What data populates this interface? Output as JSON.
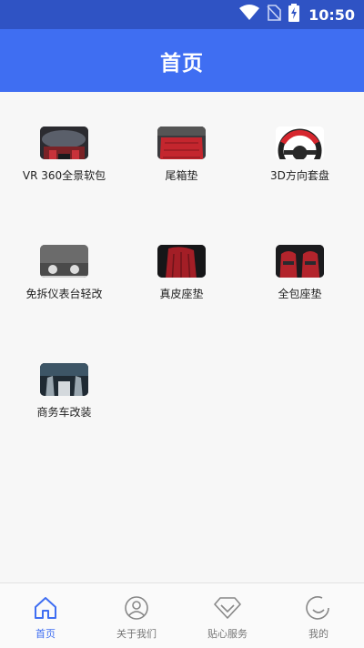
{
  "status_bar": {
    "time": "10:50",
    "icons": [
      "wifi-icon",
      "no-sim-icon",
      "battery-charging-icon"
    ]
  },
  "header": {
    "title": "首页"
  },
  "categories": [
    {
      "label": "VR 360全景软包",
      "icon": "car-interior-vr-thumbnail"
    },
    {
      "label": "尾箱垫",
      "icon": "trunk-mat-thumbnail"
    },
    {
      "label": "3D方向套盘",
      "icon": "steering-wheel-thumbnail"
    },
    {
      "label": "免拆仪表台轻改",
      "icon": "dashboard-thumbnail"
    },
    {
      "label": "真皮座垫",
      "icon": "leather-seat-thumbnail"
    },
    {
      "label": "全包座垫",
      "icon": "full-seat-cover-thumbnail"
    },
    {
      "label": "商务车改装",
      "icon": "business-van-thumbnail"
    }
  ],
  "bottom_nav": [
    {
      "label": "首页",
      "icon": "home-icon",
      "active": true
    },
    {
      "label": "关于我们",
      "icon": "person-icon",
      "active": false
    },
    {
      "label": "贴心服务",
      "icon": "diamond-icon",
      "active": false
    },
    {
      "label": "我的",
      "icon": "smile-icon",
      "active": false
    }
  ],
  "colors": {
    "status_bar": "#2f53c4",
    "app_bar": "#3f6ef2",
    "accent": "#3f6ef2",
    "background": "#f7f7f7",
    "nav_inactive": "#777777"
  }
}
